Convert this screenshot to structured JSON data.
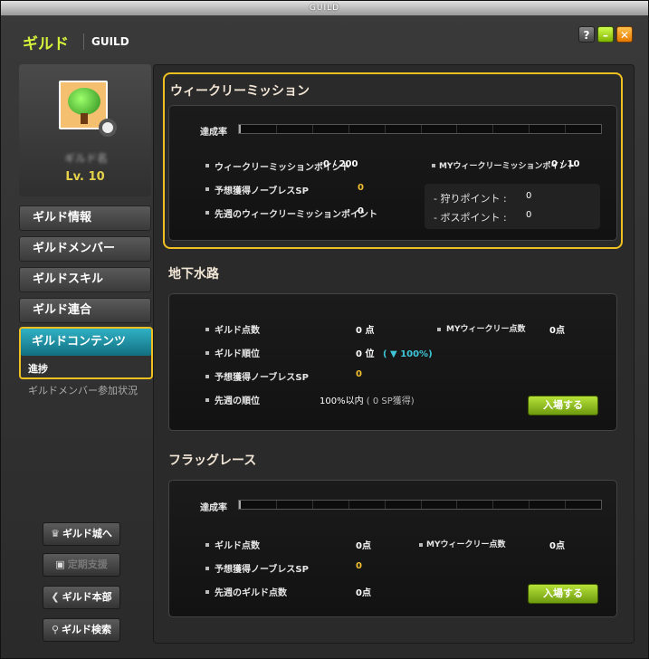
{
  "window": {
    "titlebar": "GUILD",
    "title_jp": "ギルド",
    "title_en": "GUILD"
  },
  "sidebar": {
    "guild_name": "ギルド名",
    "level": "Lv. 10",
    "nav": [
      {
        "label": "ギルド情報"
      },
      {
        "label": "ギルドメンバー"
      },
      {
        "label": "ギルドスキル"
      },
      {
        "label": "ギルド連合"
      },
      {
        "label": "ギルドコンテンツ"
      }
    ],
    "sub_progress": "進捗",
    "sub_participation": "ギルドメンバー参加状況",
    "buttons": {
      "castle": "ギルド城へ",
      "support": "定期支援",
      "hq": "ギルド本部",
      "search": "ギルド検索"
    }
  },
  "weekly": {
    "title": "ウィークリーミッション",
    "progress_label": "達成率",
    "progress_fraction": 0,
    "point_label": "ウィークリーミッションポイント",
    "point_value": "0 / 200",
    "my_point_label": "MYウィークリーミッションポイント",
    "my_point_value": "0 / 10",
    "sp_label": "予想獲得ノーブレスSP",
    "sp_value": "0",
    "last_week_label": "先週のウィークリーミッションポイント",
    "last_week_value": "0",
    "hunt_label": "- 狩りポイント :",
    "hunt_value": "0",
    "boss_label": "- ボスポイント :",
    "boss_value": "0"
  },
  "underground": {
    "title": "地下水路",
    "score_label": "ギルド点数",
    "score_value": "0",
    "score_unit": "点",
    "my_score_label": "MYウィークリー点数",
    "my_score_value": "0",
    "my_score_unit": "点",
    "rank_label": "ギルド順位",
    "rank_value": "0",
    "rank_unit": "位",
    "rank_pct_open": "(",
    "rank_pct_arrow": "▼",
    "rank_pct": "100%",
    "rank_pct_close": ")",
    "sp_label": "予想獲得ノーブレスSP",
    "sp_value": "0",
    "last_rank_label": "先週の順位",
    "last_rank_value": "100%以内",
    "last_rank_sp": "( 0 SP獲得)",
    "enter_button": "入場する"
  },
  "flag_race": {
    "title": "フラッグレース",
    "progress_label": "達成率",
    "progress_fraction": 0,
    "score_label": "ギルド点数",
    "score_value": "0",
    "score_unit": "点",
    "my_score_label": "MYウィークリー点数",
    "my_score_value": "0",
    "my_score_unit": "点",
    "sp_label": "予想獲得ノーブレスSP",
    "sp_value": "0",
    "last_score_label": "先週のギルド点数",
    "last_score_value": "0",
    "last_score_unit": "点",
    "enter_button": "入場する"
  }
}
